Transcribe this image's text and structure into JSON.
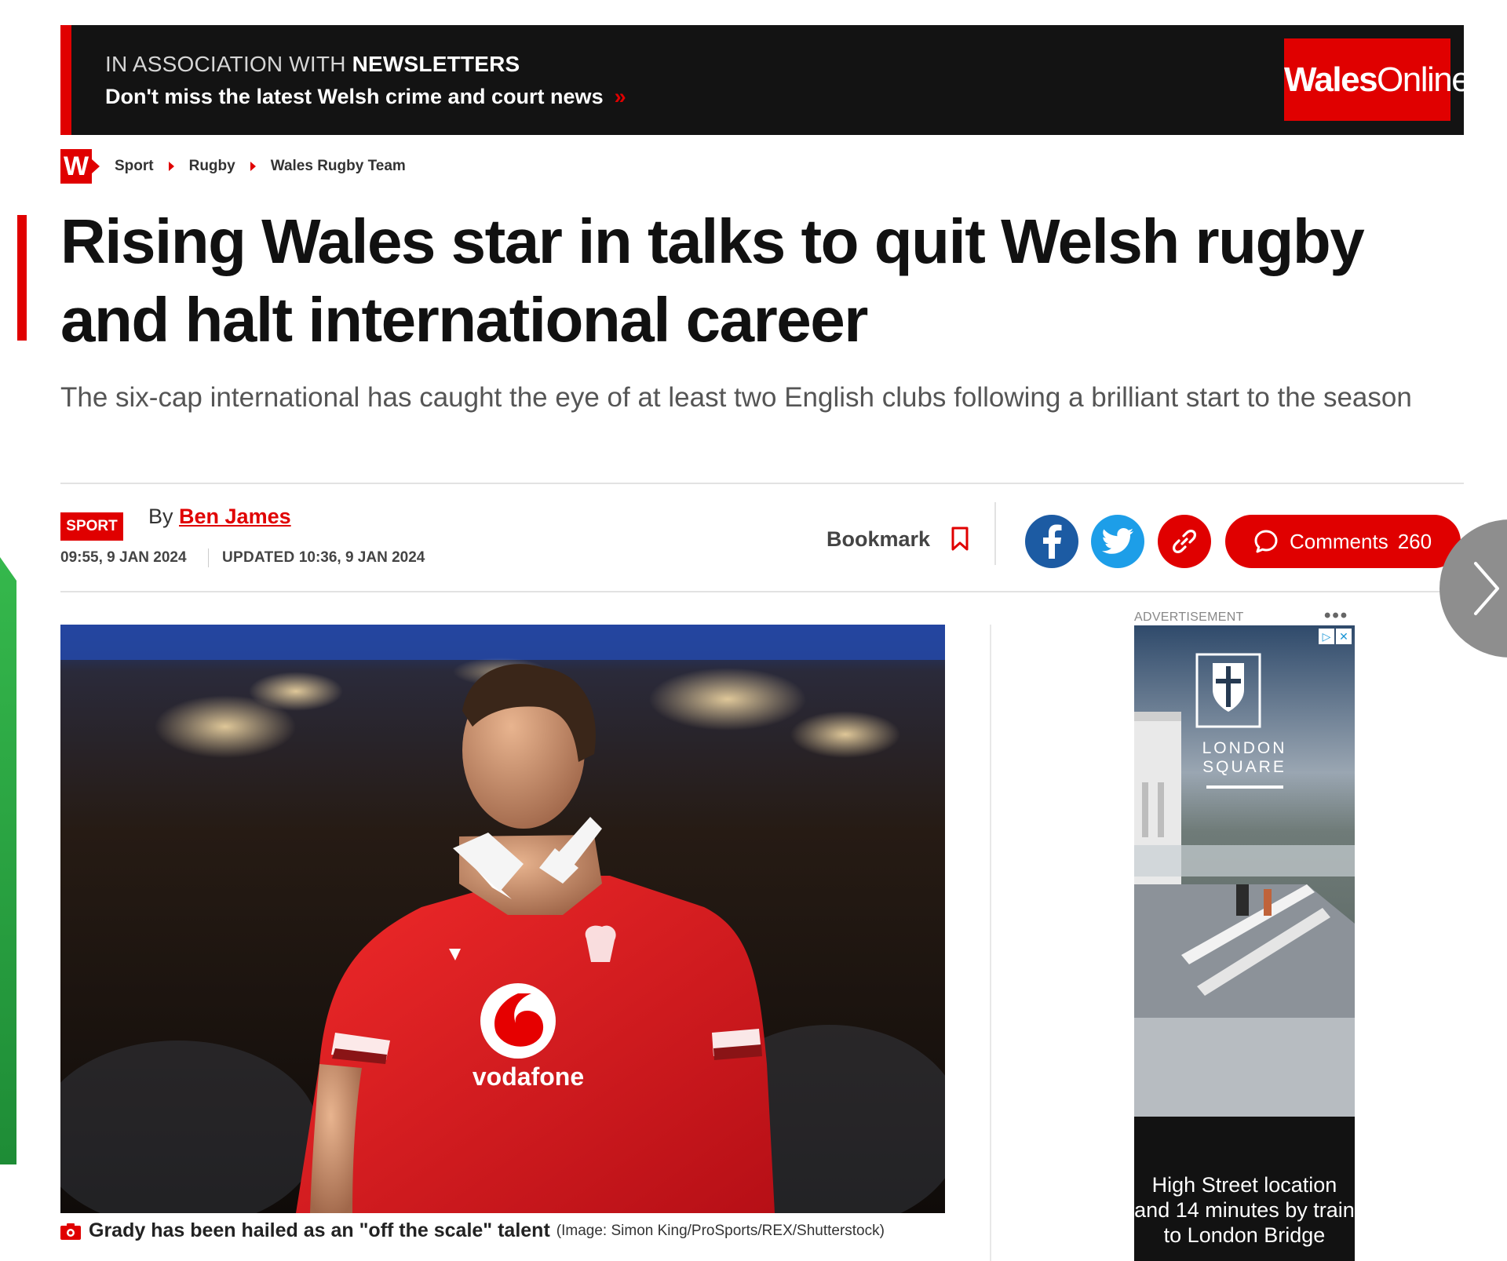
{
  "promo": {
    "prefix": "IN ASSOCIATION WITH",
    "strong": "NEWSLETTERS",
    "link_text": "Don't miss the latest Welsh crime and court news",
    "arrow": "»",
    "logo_bold": "Wales",
    "logo_light": "Online"
  },
  "breadcrumb": {
    "badge": "W",
    "items": [
      "Sport",
      "Rugby",
      "Wales Rugby Team"
    ]
  },
  "article": {
    "headline": "Rising Wales star in talks to quit Welsh rugby and halt international career",
    "standfirst": "The six-cap international has caught the eye of at least two English clubs following a brilliant start to the season",
    "tag": "SPORT",
    "by_prefix": "By",
    "author": "Ben James",
    "published": "09:55, 9 JAN 2024",
    "updated_label": "UPDATED",
    "updated": "10:36, 9 JAN 2024"
  },
  "actions": {
    "bookmark_label": "Bookmark",
    "comments_label": "Comments",
    "comments_count": "260",
    "icons": [
      "bookmark-icon",
      "facebook-icon",
      "twitter-icon",
      "link-icon",
      "comment-icon",
      "chevron-right-icon"
    ]
  },
  "hero": {
    "caption": "Grady has been hailed as an \"off the scale\" talent",
    "credit": "(Image: Simon King/ProSports/REX/Shutterstock)",
    "shirt_sponsor": "vodafone"
  },
  "ad": {
    "label": "ADVERTISEMENT",
    "brand_line1": "LONDON",
    "brand_line2": "SQUARE",
    "text": "High Street location and 14 minutes by train to London Bridge"
  },
  "colors": {
    "brand_red": "#e00000",
    "banner_dark": "#131313",
    "facebook": "#1c5ba3",
    "twitter": "#1d9ee8"
  }
}
